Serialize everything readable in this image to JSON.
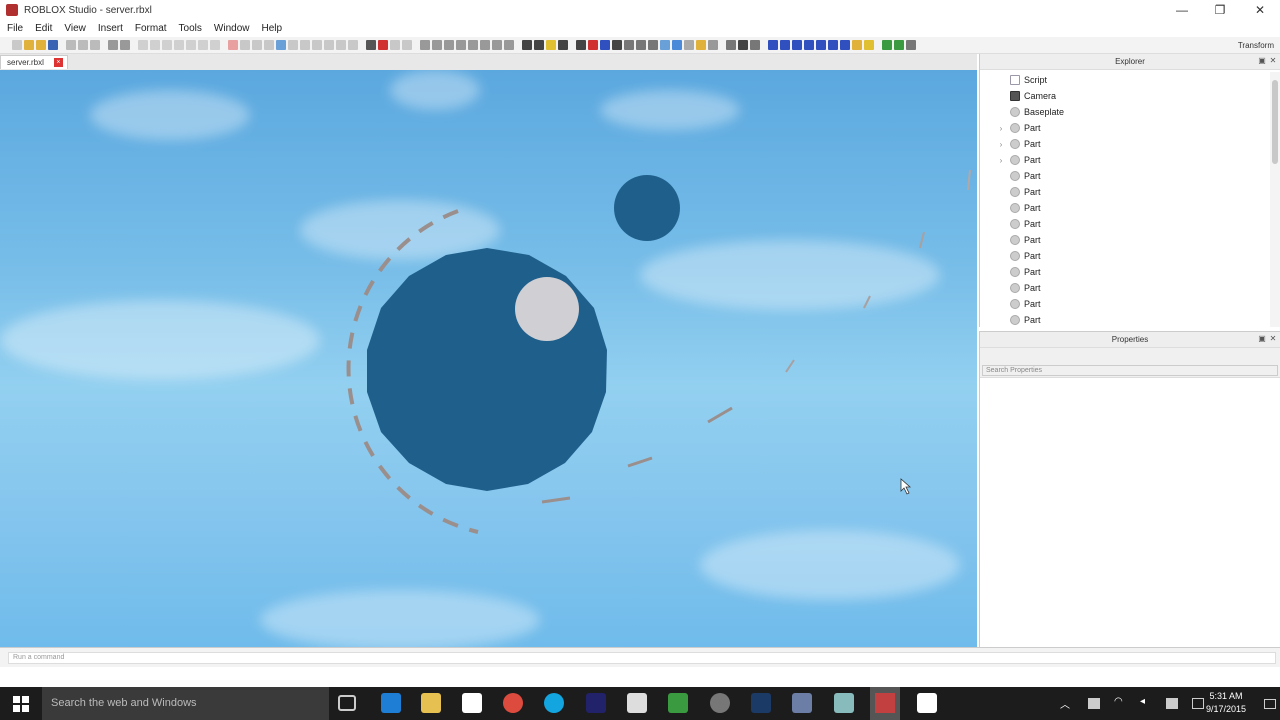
{
  "window": {
    "title": "ROBLOX Studio - server.rbxl",
    "minimize": "—",
    "maximize": "❐",
    "close": "✕"
  },
  "menu": [
    "File",
    "Edit",
    "View",
    "Insert",
    "Format",
    "Tools",
    "Window",
    "Help"
  ],
  "toolbar": {
    "label": "Transform"
  },
  "document_tab": {
    "label": "server.rbxl",
    "close": "×"
  },
  "explorer": {
    "title": "Explorer",
    "items": [
      {
        "label": "Script",
        "icon": "script-icon",
        "expandable": false
      },
      {
        "label": "Camera",
        "icon": "camera-icon",
        "expandable": false
      },
      {
        "label": "Baseplate",
        "icon": "part-icon",
        "expandable": false
      },
      {
        "label": "Part",
        "icon": "part-icon",
        "expandable": true
      },
      {
        "label": "Part",
        "icon": "part-icon",
        "expandable": true
      },
      {
        "label": "Part",
        "icon": "part-icon",
        "expandable": true
      },
      {
        "label": "Part",
        "icon": "part-icon",
        "expandable": false
      },
      {
        "label": "Part",
        "icon": "part-icon",
        "expandable": false
      },
      {
        "label": "Part",
        "icon": "part-icon",
        "expandable": false
      },
      {
        "label": "Part",
        "icon": "part-icon",
        "expandable": false
      },
      {
        "label": "Part",
        "icon": "part-icon",
        "expandable": false
      },
      {
        "label": "Part",
        "icon": "part-icon",
        "expandable": false
      },
      {
        "label": "Part",
        "icon": "part-icon",
        "expandable": false
      },
      {
        "label": "Part",
        "icon": "part-icon",
        "expandable": false
      },
      {
        "label": "Part",
        "icon": "part-icon",
        "expandable": false
      },
      {
        "label": "Part",
        "icon": "part-icon",
        "expandable": false
      }
    ]
  },
  "properties": {
    "title": "Properties",
    "search_placeholder": "Search Properties"
  },
  "command_bar": {
    "placeholder": "Run a command"
  },
  "taskbar": {
    "search_placeholder": "Search the web and Windows",
    "time": "5:31 AM",
    "date": "9/17/2015"
  },
  "colors": {
    "planet": "#1f5f8b",
    "moon": "#cfcfd4",
    "orbit": "#9a8f8c",
    "sky_top": "#5ba8df",
    "sky_bottom": "#6fbbeb"
  }
}
